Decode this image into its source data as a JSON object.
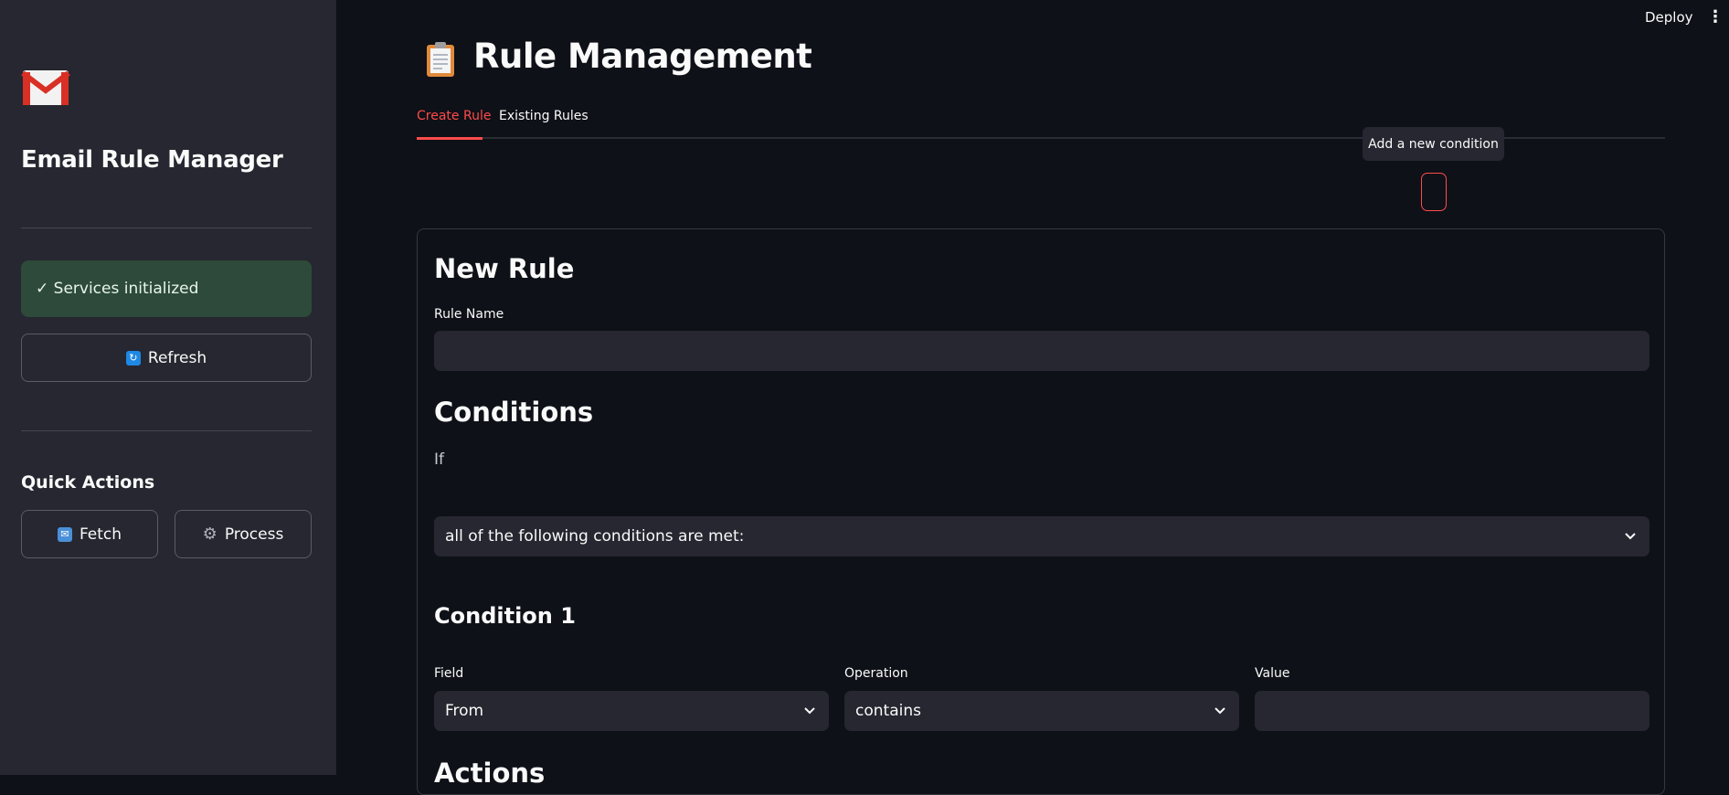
{
  "app": {
    "title": "Email Rule Manager"
  },
  "header": {
    "deploy_label": "Deploy",
    "menu_icon": "kebab-menu-icon"
  },
  "sidebar": {
    "status_text": "✓ Services initialized",
    "refresh_label": "Refresh",
    "quick_actions_title": "Quick Actions",
    "fetch_label": "Fetch",
    "process_label": "Process"
  },
  "main": {
    "page_title": "Rule Management",
    "tabs": [
      {
        "label": "Create Rule",
        "active": true
      },
      {
        "label": "Existing Rules",
        "active": false
      }
    ],
    "tooltip": "Add a new condition",
    "form": {
      "heading": "New Rule",
      "rule_name_label": "Rule Name",
      "rule_name_value": "",
      "conditions_heading": "Conditions",
      "if_text": "If",
      "match_select": "all of the following conditions are met:",
      "condition1_heading": "Condition 1",
      "field_label": "Field",
      "field_value": "From",
      "operation_label": "Operation",
      "operation_value": "contains",
      "value_label": "Value",
      "value_value": "",
      "actions_heading": "Actions"
    }
  },
  "colors": {
    "accent": "#ff4b4b",
    "background": "#0e1117",
    "sidebar": "#262730",
    "success_bg": "#2d4a3a"
  }
}
